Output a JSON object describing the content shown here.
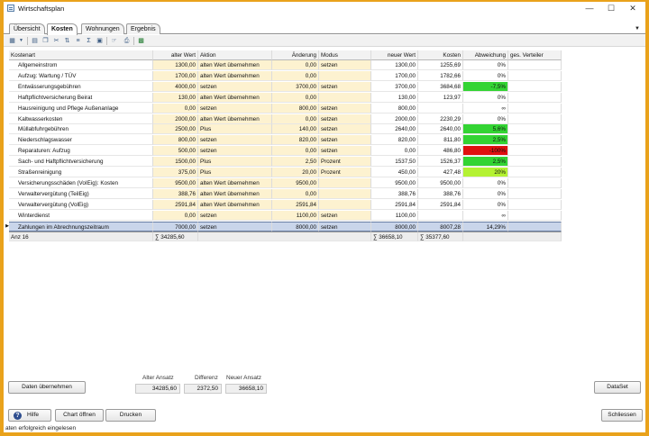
{
  "window": {
    "title": "Wirtschaftsplan",
    "controls": {
      "minimize": "—",
      "maximize": "☐",
      "close": "✕"
    }
  },
  "tabs": [
    {
      "label": "Übersicht"
    },
    {
      "label": "Kosten",
      "active": true
    },
    {
      "label": "Wohnungen"
    },
    {
      "label": "Ergebnis"
    }
  ],
  "tab_scroll_icon": "▼",
  "toolbar": {
    "icons": [
      "grid-icon",
      "dropdown-arrow-icon",
      "print-preview-icon",
      "copy-icon",
      "cut-icon",
      "sort-asc-icon",
      "sort-desc-icon",
      "sum-icon",
      "paste-icon",
      "help-pointer-icon",
      "print-icon",
      "excel-icon"
    ]
  },
  "grid": {
    "columns": [
      "Kostenart",
      "alter Wert",
      "Aktion",
      "Änderung",
      "Modus",
      "neuer Wert",
      "Kosten",
      "Abweichung",
      "ges. Verteiler"
    ],
    "rows": [
      {
        "kostenart": "Allgemeinstrom",
        "alter_wert": "1300,00",
        "aktion": "alten Wert übernehmen",
        "aenderung": "0,00",
        "modus": "setzen",
        "neuer_wert": "1300,00",
        "kosten": "1255,69",
        "abweichung": "0%",
        "color": ""
      },
      {
        "kostenart": "Aufzug: Wartung / TÜV",
        "alter_wert": "1700,00",
        "aktion": "alten Wert übernehmen",
        "aenderung": "0,00",
        "modus": "",
        "neuer_wert": "1700,00",
        "kosten": "1782,66",
        "abweichung": "0%",
        "color": ""
      },
      {
        "kostenart": "Entwässerungsgebühren",
        "alter_wert": "4000,00",
        "aktion": "setzen",
        "aenderung": "3700,00",
        "modus": "setzen",
        "neuer_wert": "3700,00",
        "kosten": "3684,68",
        "abweichung": "-7,5%",
        "color": "#33d433"
      },
      {
        "kostenart": "Haftpflichtversicherung Beirat",
        "alter_wert": "130,00",
        "aktion": "alten Wert übernehmen",
        "aenderung": "0,00",
        "modus": "",
        "neuer_wert": "130,00",
        "kosten": "123,97",
        "abweichung": "0%",
        "color": ""
      },
      {
        "kostenart": "Hausreinigung und Pflege Außenanlage",
        "alter_wert": "0,00",
        "aktion": "setzen",
        "aenderung": "800,00",
        "modus": "setzen",
        "neuer_wert": "800,00",
        "kosten": "",
        "abweichung": "∞",
        "color": ""
      },
      {
        "kostenart": "Kaltwasserkosten",
        "alter_wert": "2000,00",
        "aktion": "alten Wert übernehmen",
        "aenderung": "0,00",
        "modus": "setzen",
        "neuer_wert": "2000,00",
        "kosten": "2230,29",
        "abweichung": "0%",
        "color": ""
      },
      {
        "kostenart": "Müllabfuhrgebühren",
        "alter_wert": "2500,00",
        "aktion": "Plus",
        "aenderung": "140,00",
        "modus": "setzen",
        "neuer_wert": "2640,00",
        "kosten": "2640,00",
        "abweichung": "5,6%",
        "color": "#33d433"
      },
      {
        "kostenart": "Niederschlagswasser",
        "alter_wert": "800,00",
        "aktion": "setzen",
        "aenderung": "820,00",
        "modus": "setzen",
        "neuer_wert": "820,00",
        "kosten": "811,80",
        "abweichung": "2,5%",
        "color": "#33d433"
      },
      {
        "kostenart": "Reparaturen: Aufzug",
        "alter_wert": "500,00",
        "aktion": "setzen",
        "aenderung": "0,00",
        "modus": "setzen",
        "neuer_wert": "0,00",
        "kosten": "486,80",
        "abweichung": "-100%",
        "color": "#e01010"
      },
      {
        "kostenart": "Sach- und Haftpflichtversicherung",
        "alter_wert": "1500,00",
        "aktion": "Plus",
        "aenderung": "2,50",
        "modus": "Prozent",
        "neuer_wert": "1537,50",
        "kosten": "1526,37",
        "abweichung": "2,5%",
        "color": "#33d433"
      },
      {
        "kostenart": "Straßenreinigung",
        "alter_wert": "375,00",
        "aktion": "Plus",
        "aenderung": "20,00",
        "modus": "Prozent",
        "neuer_wert": "450,00",
        "kosten": "427,48",
        "abweichung": "20%",
        "color": "#b4f233"
      },
      {
        "kostenart": "Versicherungsschäden (VoIEig): Kosten",
        "alter_wert": "9500,00",
        "aktion": "alten Wert übernehmen",
        "aenderung": "9500,00",
        "modus": "",
        "neuer_wert": "9500,00",
        "kosten": "9500,00",
        "abweichung": "0%",
        "color": ""
      },
      {
        "kostenart": "Verwaltervergütung (TeilEig)",
        "alter_wert": "388,76",
        "aktion": "alten Wert übernehmen",
        "aenderung": "0,00",
        "modus": "",
        "neuer_wert": "388,76",
        "kosten": "388,76",
        "abweichung": "0%",
        "color": ""
      },
      {
        "kostenart": "Verwaltervergütung (VolEig)",
        "alter_wert": "2591,84",
        "aktion": "alten Wert übernehmen",
        "aenderung": "2591,84",
        "modus": "",
        "neuer_wert": "2591,84",
        "kosten": "2591,84",
        "abweichung": "0%",
        "color": ""
      },
      {
        "kostenart": "Winterdienst",
        "alter_wert": "0,00",
        "aktion": "setzen",
        "aenderung": "1100,00",
        "modus": "setzen",
        "neuer_wert": "1100,00",
        "kosten": "",
        "abweichung": "∞",
        "color": ""
      },
      {
        "kostenart": "Zahlungen im Abrechnungszeitraum",
        "alter_wert": "7000,00",
        "aktion": "setzen",
        "aenderung": "8000,00",
        "modus": "setzen",
        "neuer_wert": "8000,00",
        "kosten": "8007,28",
        "abweichung": "14,29%",
        "color": "",
        "selected": true
      }
    ],
    "footer": {
      "count": "Anz 16",
      "alter_wert_sum": "∑ 34285,60",
      "neuer_wert_sum": "∑ 36658,10",
      "kosten_sum": "∑ 35377,60"
    },
    "row_marker": "▶"
  },
  "summary": {
    "alter_ansatz_label": "Alter Ansatz",
    "alter_ansatz_value": "34285,60",
    "differenz_label": "Differenz",
    "differenz_value": "2372,50",
    "neuer_ansatz_label": "Neuer Ansatz",
    "neuer_ansatz_value": "36658,10"
  },
  "buttons": {
    "daten_uebernehmen": "Daten übernehmen",
    "dataset": "DataSet",
    "hilfe": "Hilfe",
    "hilfe_icon": "?",
    "chart_oeffnen": "Chart öffnen",
    "drucken": "Drucken",
    "schliessen": "Schliessen"
  },
  "status": "aten erfolgreich eingelesen"
}
